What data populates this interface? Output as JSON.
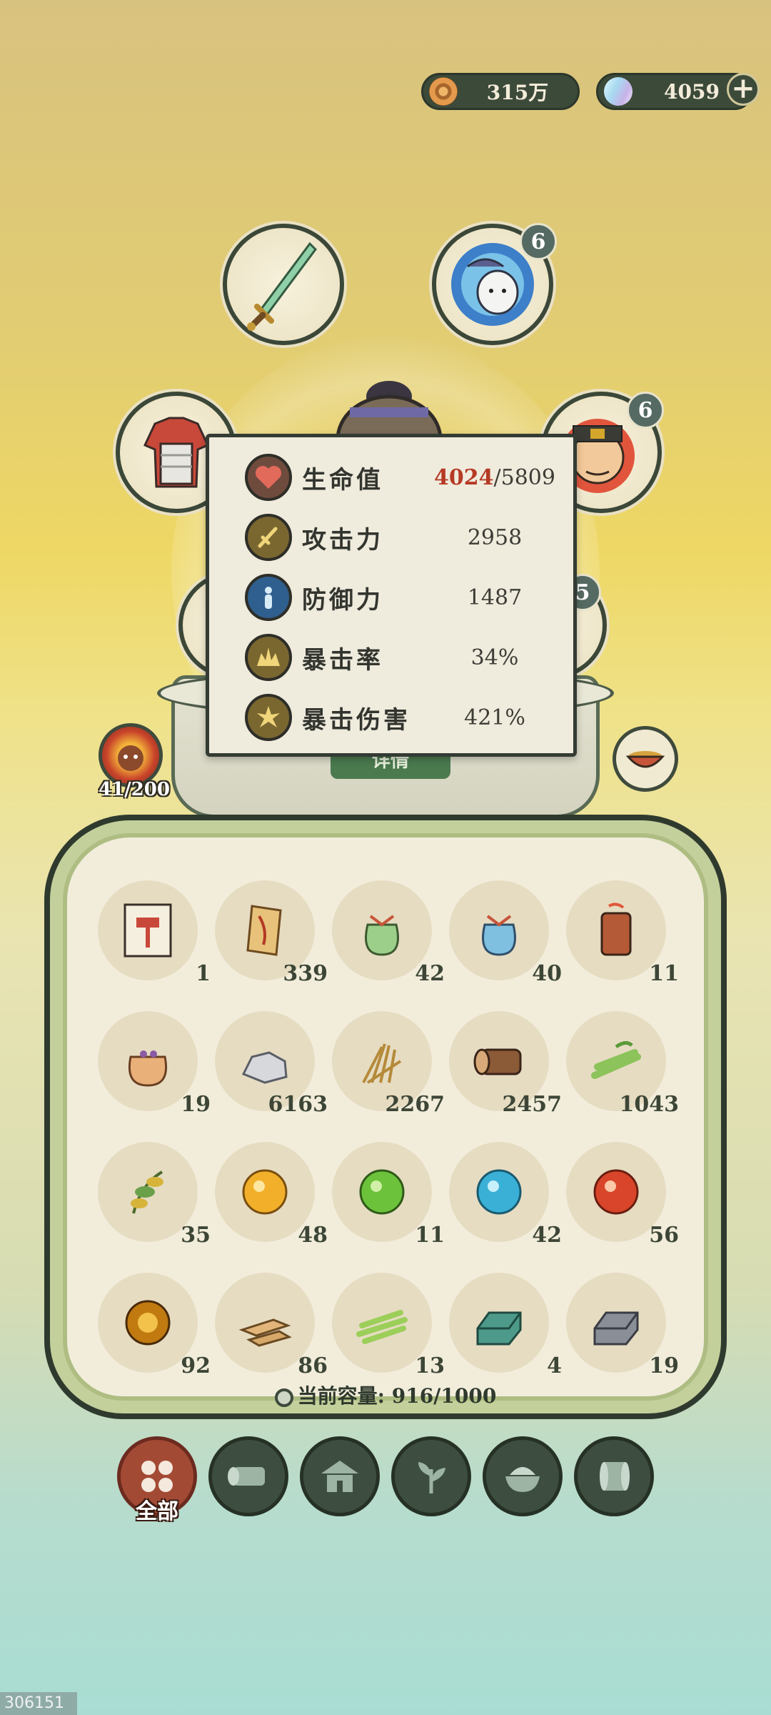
{
  "currency": {
    "coins": "315万",
    "gems": "4059",
    "add_label": "+"
  },
  "equipment": {
    "mount_badge": "6",
    "companion_badge": "6",
    "hidden_badge": "5"
  },
  "stats": [
    {
      "name": "生命值",
      "current": "4024",
      "max": "/5809",
      "icon": "heart-icon",
      "color": "#d95b4b"
    },
    {
      "name": "攻击力",
      "value": "2958",
      "icon": "attack-icon",
      "color": "#c9a640"
    },
    {
      "name": "防御力",
      "value": "1487",
      "icon": "defense-icon",
      "color": "#3e78b9"
    },
    {
      "name": "暴击率",
      "value": "34%",
      "icon": "crit-rate-icon",
      "color": "#c9a640"
    },
    {
      "name": "暴击伤害",
      "value": "421%",
      "icon": "crit-damage-icon",
      "color": "#c9a640"
    }
  ],
  "detail_button": "详情",
  "level": "41/200",
  "inventory": {
    "items": [
      {
        "icon": "hammer-scroll-icon",
        "count": "1"
      },
      {
        "icon": "paper-charm-icon",
        "count": "339"
      },
      {
        "icon": "green-pouch-icon",
        "count": "42"
      },
      {
        "icon": "blue-pouch-icon",
        "count": "40"
      },
      {
        "icon": "wooden-token-icon",
        "count": "11"
      },
      {
        "icon": "coin-pouch-icon",
        "count": "19"
      },
      {
        "icon": "stone-icon",
        "count": "6163"
      },
      {
        "icon": "straw-icon",
        "count": "2267"
      },
      {
        "icon": "log-icon",
        "count": "2457"
      },
      {
        "icon": "bamboo-icon",
        "count": "1043"
      },
      {
        "icon": "herb-icon",
        "count": "35"
      },
      {
        "icon": "yellow-orb-icon",
        "count": "48"
      },
      {
        "icon": "green-orb-icon",
        "count": "11"
      },
      {
        "icon": "blue-orb-icon",
        "count": "42"
      },
      {
        "icon": "red-orb-icon",
        "count": "56"
      },
      {
        "icon": "amber-orb-icon",
        "count": "92"
      },
      {
        "icon": "plank-icon",
        "count": "86"
      },
      {
        "icon": "bamboo-strips-icon",
        "count": "13"
      },
      {
        "icon": "jade-ingot-icon",
        "count": "4"
      },
      {
        "icon": "iron-ingot-icon",
        "count": "19"
      }
    ],
    "capacity_label": "当前容量:",
    "capacity_value": "916/1000"
  },
  "tabs": {
    "all_label": "全部"
  },
  "footer_id": "306151"
}
